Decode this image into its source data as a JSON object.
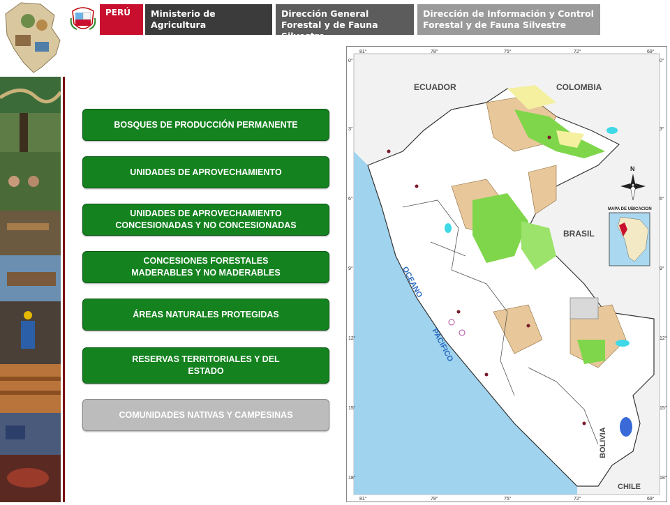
{
  "header": {
    "peru": "PERÚ",
    "ministry": "Ministerio de Agricultura",
    "directorate_forestal": "Dirección General Forestal y de Fauna Silvestre",
    "directorate_info": "Dirección de Información y Control Forestal y de Fauna Silvestre"
  },
  "menu": {
    "items": [
      {
        "label": "BOSQUES DE PRODUCCIÓN PERMANENTE",
        "style": "green"
      },
      {
        "label": "UNIDADES DE APROVECHAMIENTO",
        "style": "green"
      },
      {
        "label": "UNIDADES DE APROVECHAMIENTO CONCESIONADAS Y NO CONCESIONADAS",
        "style": "green"
      },
      {
        "label": "CONCESIONES FORESTALES MADERABLES Y NO MADERABLES",
        "style": "green"
      },
      {
        "label": "ÁREAS NATURALES PROTEGIDAS",
        "style": "green"
      },
      {
        "label": "RESERVAS TERRITORIALES Y DEL ESTADO",
        "style": "green"
      },
      {
        "label": "COMUNIDADES NATIVAS Y CAMPESINAS",
        "style": "gray"
      }
    ]
  },
  "map": {
    "labels": {
      "ecuador": "ECUADOR",
      "colombia": "COLOMBIA",
      "brasil": "BRASIL",
      "bolivia": "BOLIVIA",
      "chile": "CHILE",
      "oceano": "OCEANO",
      "pacifico": "PACIFICO",
      "north": "N",
      "inset_title": "MAPA DE UBICACION"
    },
    "lon_ticks": [
      "81°",
      "78°",
      "75°",
      "72°",
      "69°"
    ],
    "lat_ticks": [
      "0°",
      "3°",
      "6°",
      "9°",
      "12°",
      "15°",
      "18°"
    ]
  },
  "colors": {
    "green_button": "#14821f",
    "gray_button": "#bcbcbc",
    "peru_red": "#c8102e",
    "ocean": "#9fd3ee",
    "forest": "#7fd64a",
    "tan": "#e8c79a"
  }
}
